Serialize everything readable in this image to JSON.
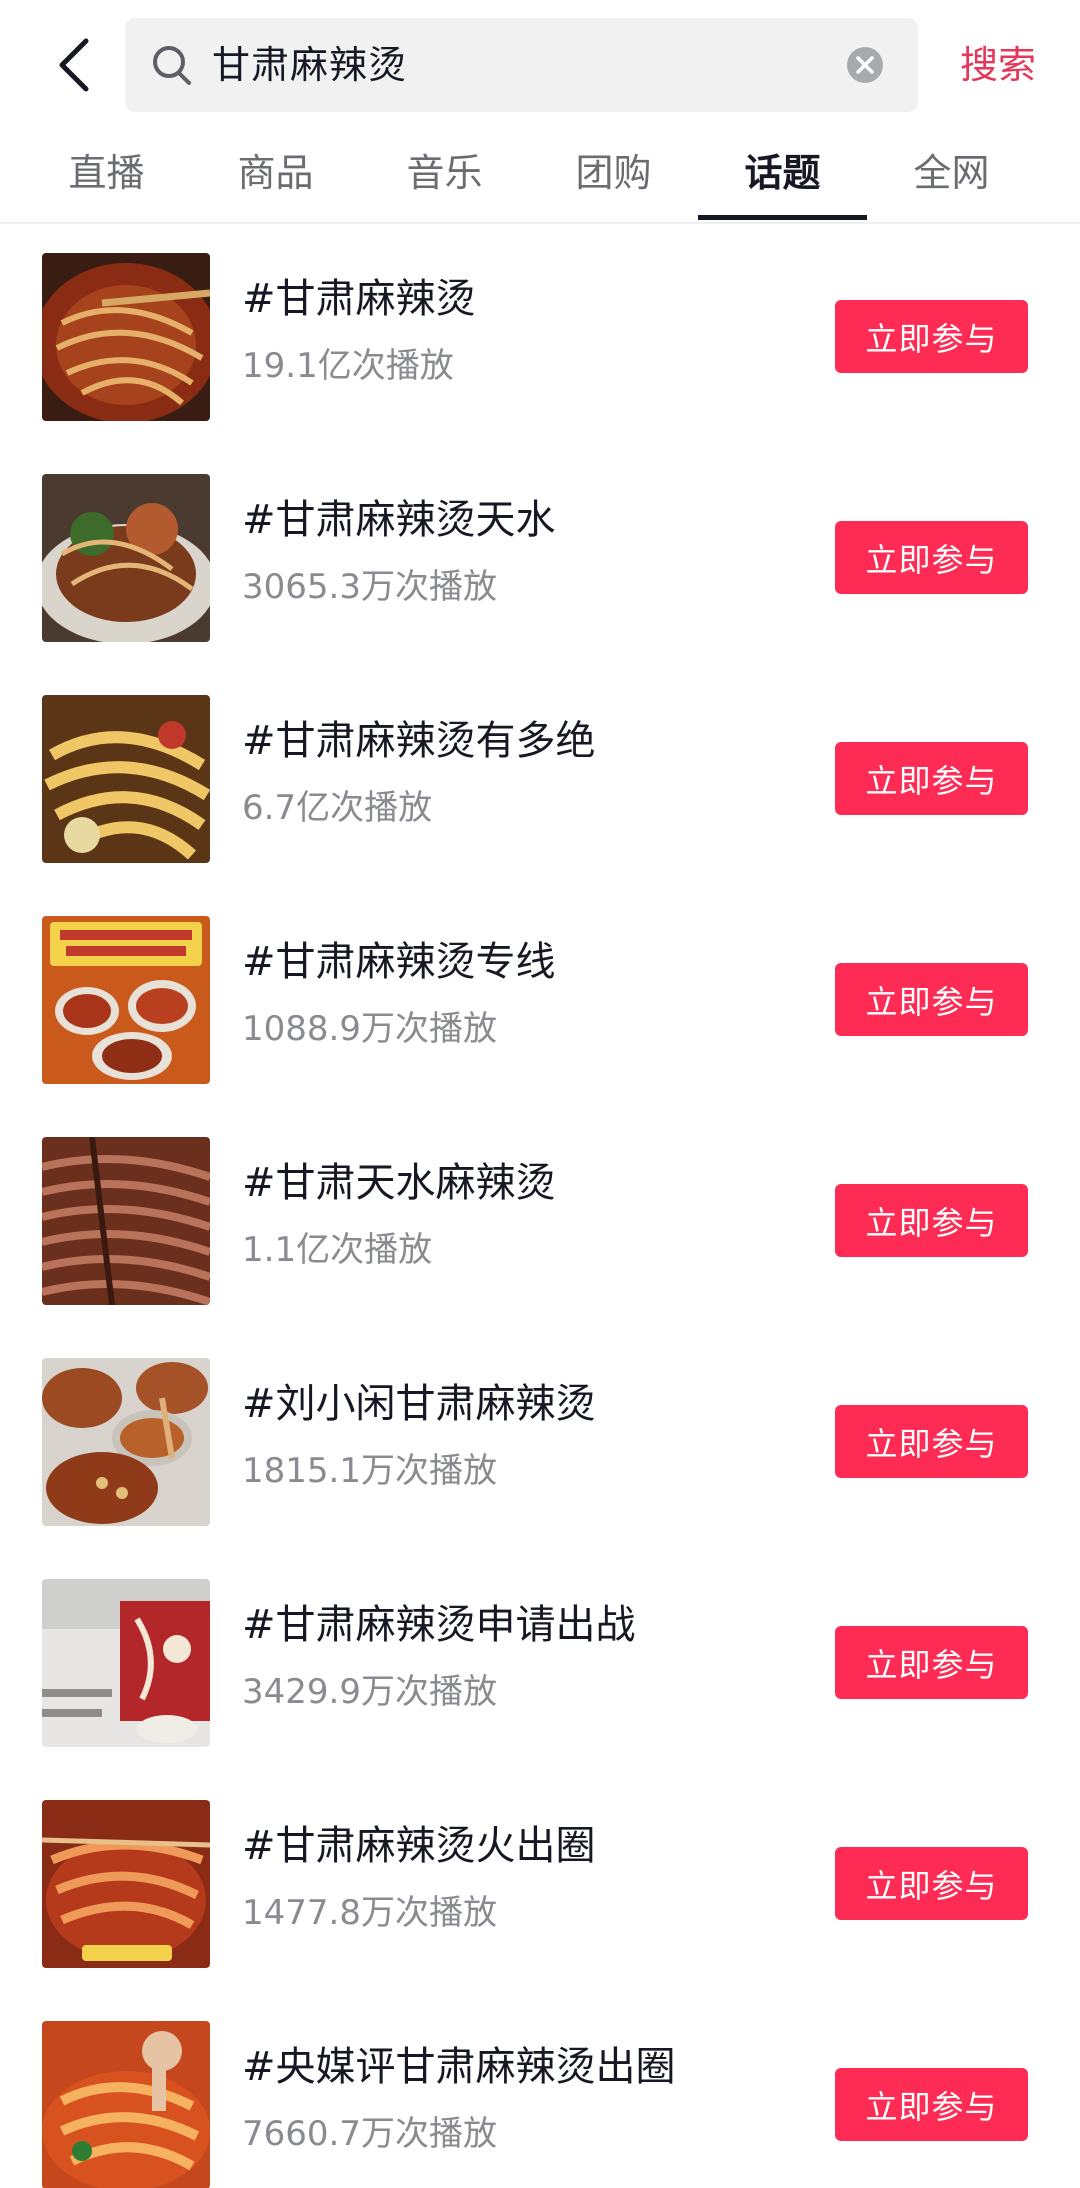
{
  "search": {
    "query": "甘肃麻辣烫",
    "submit_label": "搜索"
  },
  "tabs": [
    {
      "label": "直播"
    },
    {
      "label": "商品"
    },
    {
      "label": "音乐"
    },
    {
      "label": "团购"
    },
    {
      "label": "话题",
      "active": true
    },
    {
      "label": "全网"
    }
  ],
  "topics": [
    {
      "title": "#甘肃麻辣烫",
      "plays": "19.1亿次播放",
      "button": "立即参与"
    },
    {
      "title": "#甘肃麻辣烫天水",
      "plays": "3065.3万次播放",
      "button": "立即参与"
    },
    {
      "title": "#甘肃麻辣烫有多绝",
      "plays": "6.7亿次播放",
      "button": "立即参与"
    },
    {
      "title": "#甘肃麻辣烫专线",
      "plays": "1088.9万次播放",
      "button": "立即参与"
    },
    {
      "title": "#甘肃天水麻辣烫",
      "plays": "1.1亿次播放",
      "button": "立即参与"
    },
    {
      "title": "#刘小闲甘肃麻辣烫",
      "plays": "1815.1万次播放",
      "button": "立即参与"
    },
    {
      "title": "#甘肃麻辣烫申请出战",
      "plays": "3429.9万次播放",
      "button": "立即参与"
    },
    {
      "title": "#甘肃麻辣烫火出圈",
      "plays": "1477.8万次播放",
      "button": "立即参与"
    },
    {
      "title": "#央媒评甘肃麻辣烫出圈",
      "plays": "7660.7万次播放",
      "button": "立即参与"
    }
  ],
  "colors": {
    "accent": "#fe2c55",
    "search_link": "#e4375a",
    "text_primary": "#161823",
    "text_secondary": "#8a8b91"
  }
}
